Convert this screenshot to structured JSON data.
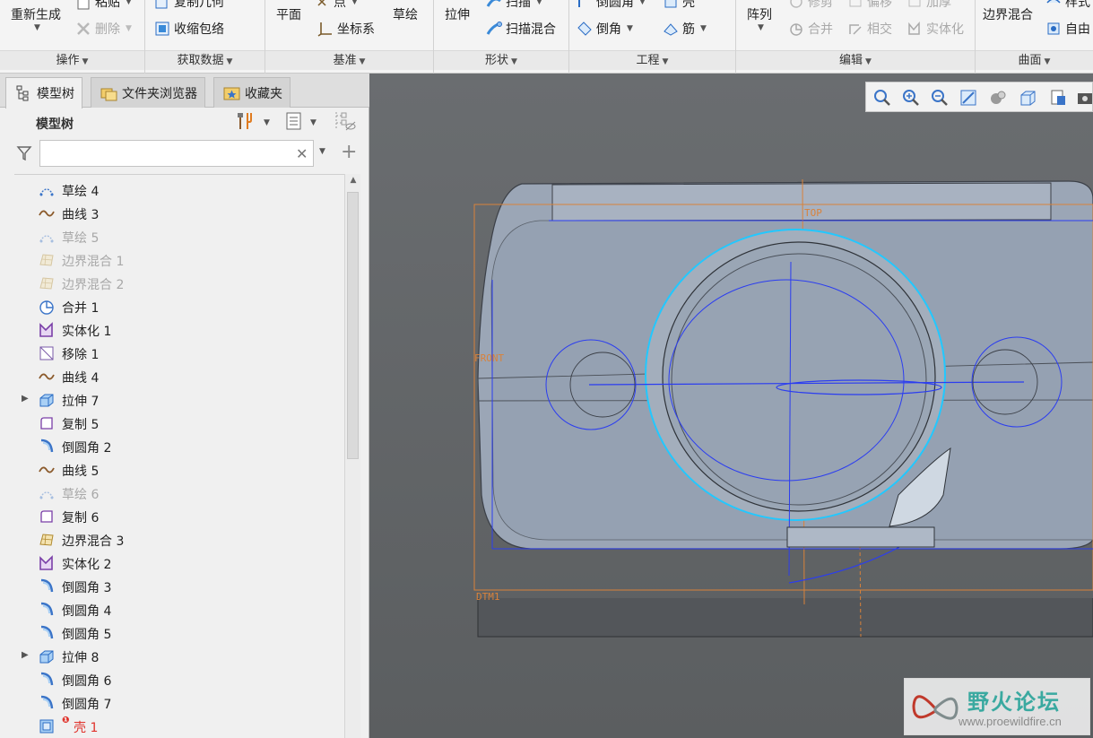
{
  "ribbon": {
    "groups": [
      {
        "label": "操作",
        "buttons": {
          "regenerate": "重新生成",
          "paste": "粘贴",
          "delete": "删除"
        }
      },
      {
        "label": "获取数据",
        "buttons": {
          "copy_geom": "复制几何",
          "shrinkwrap": "收缩包络"
        }
      },
      {
        "label": "基准",
        "buttons": {
          "plane": "平面",
          "point": "点",
          "coord_sys": "坐标系",
          "sketch": "草绘"
        }
      },
      {
        "label": "形状",
        "buttons": {
          "extrude": "拉伸",
          "sweep": "扫描",
          "swept_blend": "扫描混合"
        }
      },
      {
        "label": "工程",
        "buttons": {
          "round": "倒圆角",
          "shell": "壳",
          "chamfer": "倒角",
          "rib": "筋"
        }
      },
      {
        "label": "编辑",
        "buttons": {
          "pattern": "阵列",
          "trim": "修剪",
          "offset": "偏移",
          "thicken": "加厚",
          "merge": "合并",
          "intersect": "相交",
          "solidify": "实体化"
        }
      },
      {
        "label": "曲面",
        "buttons": {
          "boundary_blend": "边界混合",
          "style": "样式",
          "freestyle": "自由"
        }
      }
    ]
  },
  "tabs": [
    {
      "label": "模型树",
      "icon": "model-tree-icon"
    },
    {
      "label": "文件夹浏览器",
      "icon": "folder-icon"
    },
    {
      "label": "收藏夹",
      "icon": "favorites-icon"
    }
  ],
  "tree_header": {
    "title": "模型树"
  },
  "filter": {
    "value": "",
    "placeholder": ""
  },
  "tree_items": [
    {
      "label": "草绘 4",
      "icon": "sketch",
      "state": "normal",
      "expand": false
    },
    {
      "label": "曲线 3",
      "icon": "curve",
      "state": "normal",
      "expand": false
    },
    {
      "label": "草绘 5",
      "icon": "sketch",
      "state": "dim",
      "expand": false
    },
    {
      "label": "边界混合 1",
      "icon": "boundary",
      "state": "dim",
      "expand": false
    },
    {
      "label": "边界混合 2",
      "icon": "boundary",
      "state": "dim",
      "expand": false
    },
    {
      "label": "合并 1",
      "icon": "merge",
      "state": "normal",
      "expand": false
    },
    {
      "label": "实体化 1",
      "icon": "solidify",
      "state": "normal",
      "expand": false
    },
    {
      "label": "移除 1",
      "icon": "remove",
      "state": "normal",
      "expand": false
    },
    {
      "label": "曲线 4",
      "icon": "curve",
      "state": "normal",
      "expand": false
    },
    {
      "label": "拉伸 7",
      "icon": "extrude",
      "state": "normal",
      "expand": true
    },
    {
      "label": "复制 5",
      "icon": "copy",
      "state": "normal",
      "expand": false
    },
    {
      "label": "倒圆角 2",
      "icon": "round",
      "state": "normal",
      "expand": false
    },
    {
      "label": "曲线 5",
      "icon": "curve",
      "state": "normal",
      "expand": false
    },
    {
      "label": "草绘 6",
      "icon": "sketch",
      "state": "dim",
      "expand": false
    },
    {
      "label": "复制 6",
      "icon": "copy",
      "state": "normal",
      "expand": false
    },
    {
      "label": "边界混合 3",
      "icon": "boundary",
      "state": "normal",
      "expand": false
    },
    {
      "label": "实体化 2",
      "icon": "solidify",
      "state": "normal",
      "expand": false
    },
    {
      "label": "倒圆角 3",
      "icon": "round",
      "state": "normal",
      "expand": false
    },
    {
      "label": "倒圆角 4",
      "icon": "round",
      "state": "normal",
      "expand": false
    },
    {
      "label": "倒圆角 5",
      "icon": "round",
      "state": "normal",
      "expand": false
    },
    {
      "label": "拉伸 8",
      "icon": "extrude",
      "state": "normal",
      "expand": true
    },
    {
      "label": "倒圆角 6",
      "icon": "round",
      "state": "normal",
      "expand": false
    },
    {
      "label": "倒圆角 7",
      "icon": "round",
      "state": "normal",
      "expand": false
    },
    {
      "label": "壳 1",
      "icon": "shell",
      "state": "error",
      "expand": false
    }
  ],
  "viewport": {
    "datum_labels": {
      "top": "TOP",
      "front": "FRONT",
      "dtm": "DTM1"
    }
  },
  "watermark": {
    "title": "野火论坛",
    "url": "www.proewildfire.cn"
  },
  "colors": {
    "ribbon_bg": "#f4f4f4",
    "model_surface": "#9aa6b6",
    "datum_orange": "#d9823a",
    "sketch_blue": "#2b3df0",
    "highlight_cyan": "#22c8ff",
    "error_red": "#e0322b"
  }
}
